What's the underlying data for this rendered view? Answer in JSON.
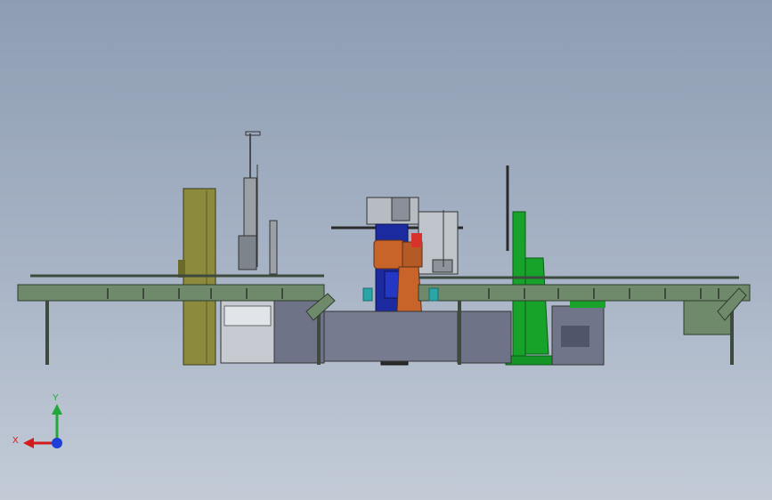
{
  "view": {
    "background_top": "#8e9db3",
    "background_bottom": "#c3cbd7"
  },
  "colors": {
    "frame_green": "#6f8a6a",
    "frame_dark": "#3d4a3d",
    "olive_panel": "#8c8a3c",
    "robot_orange": "#c8642a",
    "robot_dark": "#5a2f18",
    "blue_column": "#1c2aa0",
    "bright_green": "#17a22a",
    "steel_gray": "#8e959c",
    "base_slate": "#6f7387",
    "teal": "#2aa6a6"
  },
  "triad": {
    "x_label": "X",
    "y_label": "Y",
    "x_color": "#d41b1b",
    "y_color": "#22a83a",
    "z_color": "#1d3fd8"
  }
}
